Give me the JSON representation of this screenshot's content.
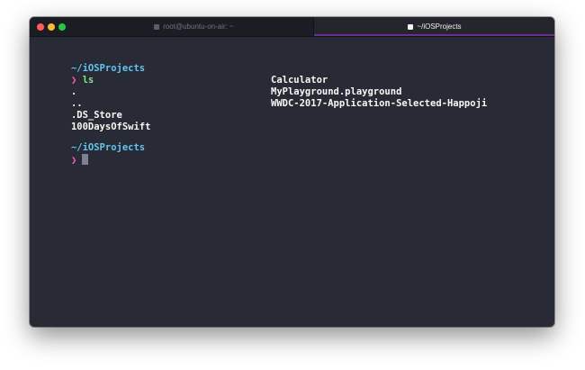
{
  "window": {
    "tabs": [
      {
        "label": "root@ubuntu-on-air: ~",
        "active": false
      },
      {
        "label": "~/iOSProjects",
        "active": true
      }
    ]
  },
  "terminal": {
    "cwd_1": "~/iOSProjects",
    "prompt_symbol": "❯",
    "command": "ls",
    "listing_col1": [
      ".",
      "..",
      ".DS_Store",
      "100DaysOfSwift"
    ],
    "listing_col2": [
      "Calculator",
      "MyPlayground.playground",
      "WWDC-2017-Application-Selected-Happoji"
    ],
    "cwd_2": "~/iOSProjects"
  },
  "colors": {
    "background": "#282a36",
    "cwd": "#62c6ee",
    "prompt": "#ff5fb6",
    "command": "#86e38c",
    "text": "#f8f8f2"
  }
}
